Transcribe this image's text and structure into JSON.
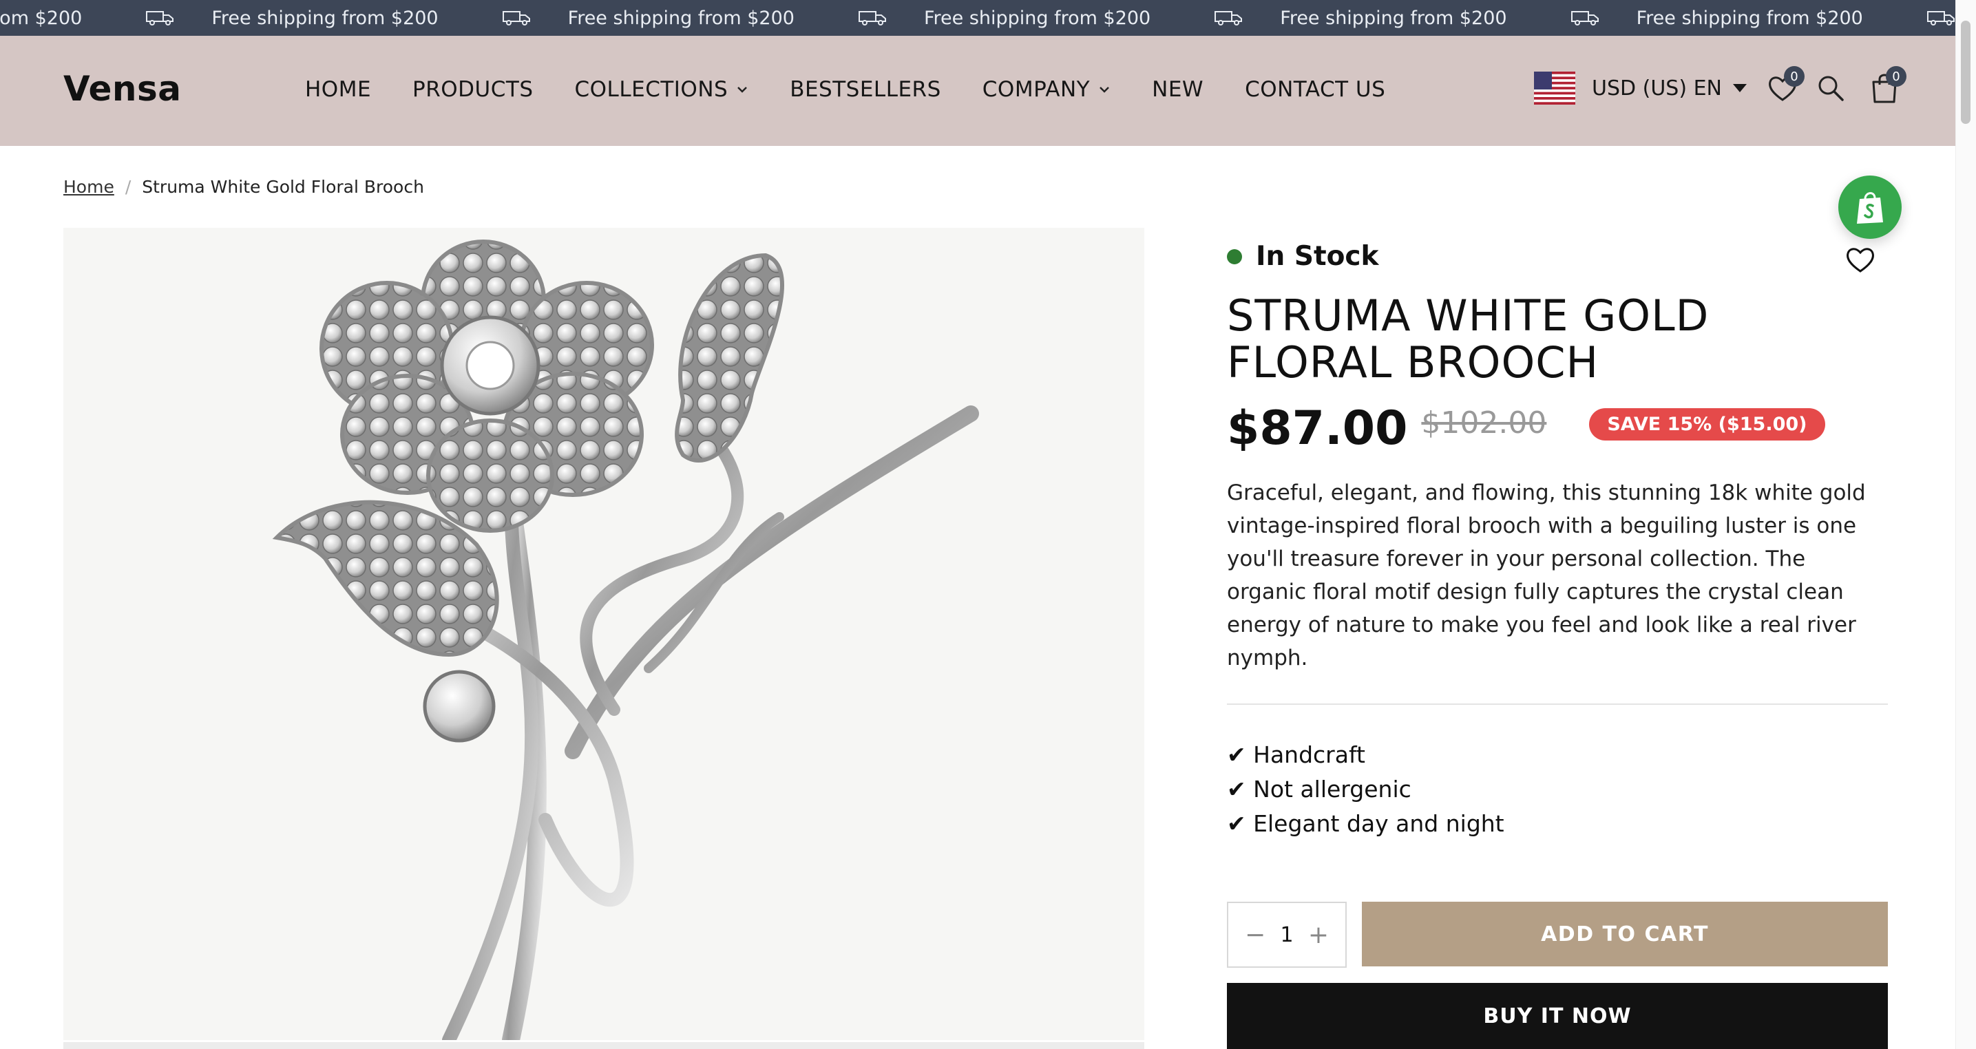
{
  "announcement": {
    "text": "Free shipping from $200",
    "icon": "truck-icon"
  },
  "header": {
    "logo": "Vensa",
    "nav": [
      {
        "label": "HOME",
        "has_dropdown": false
      },
      {
        "label": "PRODUCTS",
        "has_dropdown": false
      },
      {
        "label": "COLLECTIONS",
        "has_dropdown": true
      },
      {
        "label": "BESTSELLERS",
        "has_dropdown": false
      },
      {
        "label": "COMPANY",
        "has_dropdown": true
      },
      {
        "label": "NEW",
        "has_dropdown": false
      },
      {
        "label": "CONTACT US",
        "has_dropdown": false
      }
    ],
    "currency": "USD (US) EN",
    "wishlist_count": "0",
    "cart_count": "0"
  },
  "breadcrumb": {
    "home": "Home",
    "current": "Struma White Gold Floral Brooch"
  },
  "product": {
    "stock": "In Stock",
    "title": "STRUMA WHITE GOLD FLORAL BROOCH",
    "price": "$87.00",
    "compare_price": "$102.00",
    "save_badge": "SAVE 15% ($15.00)",
    "description": "Graceful, elegant, and flowing, this stunning 18k white gold vintage-inspired floral brooch with a beguiling luster is one you'll treasure forever in your personal collection. The organic floral motif design fully captures the crystal clean energy of nature to make you feel and look like a real river nymph.",
    "features": [
      "✔ Handcraft",
      "✔ Not allergenic",
      "✔ Elegant day and night"
    ],
    "quantity": "1",
    "add_to_cart": "ADD TO CART",
    "buy_now": "BUY IT NOW"
  },
  "colors": {
    "announcement_bg": "#3d4657",
    "header_bg": "#d5c6c4",
    "in_stock": "#2e7d32",
    "save_badge": "#e54a4a",
    "add_to_cart": "#b49f86",
    "buy_now": "#121212"
  }
}
